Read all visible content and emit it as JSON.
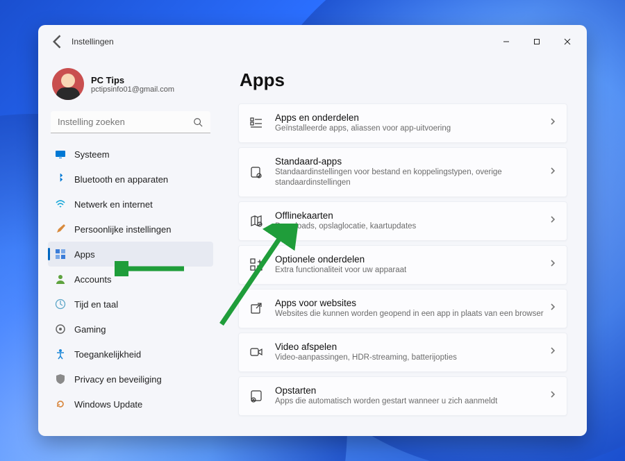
{
  "window": {
    "title": "Instellingen"
  },
  "profile": {
    "name": "PC Tips",
    "email": "pctipsinfo01@gmail.com"
  },
  "search": {
    "placeholder": "Instelling zoeken"
  },
  "sidebar": {
    "items": [
      {
        "label": "Systeem"
      },
      {
        "label": "Bluetooth en apparaten"
      },
      {
        "label": "Netwerk en internet"
      },
      {
        "label": "Persoonlijke instellingen"
      },
      {
        "label": "Apps"
      },
      {
        "label": "Accounts"
      },
      {
        "label": "Tijd en taal"
      },
      {
        "label": "Gaming"
      },
      {
        "label": "Toegankelijkheid"
      },
      {
        "label": "Privacy en beveiliging"
      },
      {
        "label": "Windows Update"
      }
    ],
    "active_index": 4
  },
  "page": {
    "title": "Apps"
  },
  "cards": [
    {
      "title": "Apps en onderdelen",
      "subtitle": "Geïnstalleerde apps, aliassen voor app-uitvoering"
    },
    {
      "title": "Standaard-apps",
      "subtitle": "Standaardinstellingen voor bestand en koppelingstypen, overige standaardinstellingen"
    },
    {
      "title": "Offlinekaarten",
      "subtitle": "Downloads, opslaglocatie, kaartupdates"
    },
    {
      "title": "Optionele onderdelen",
      "subtitle": "Extra functionaliteit voor uw apparaat"
    },
    {
      "title": "Apps voor websites",
      "subtitle": "Websites die kunnen worden geopend in een app in plaats van een browser"
    },
    {
      "title": "Video afspelen",
      "subtitle": "Video-aanpassingen, HDR-streaming, batterijopties"
    },
    {
      "title": "Opstarten",
      "subtitle": "Apps die automatisch worden gestart wanneer u zich aanmeldt"
    }
  ],
  "annotations": {
    "arrow_to_sidebar_apps": true,
    "arrow_to_offlinekaarten": true,
    "arrow_color": "#1f9d3a"
  }
}
